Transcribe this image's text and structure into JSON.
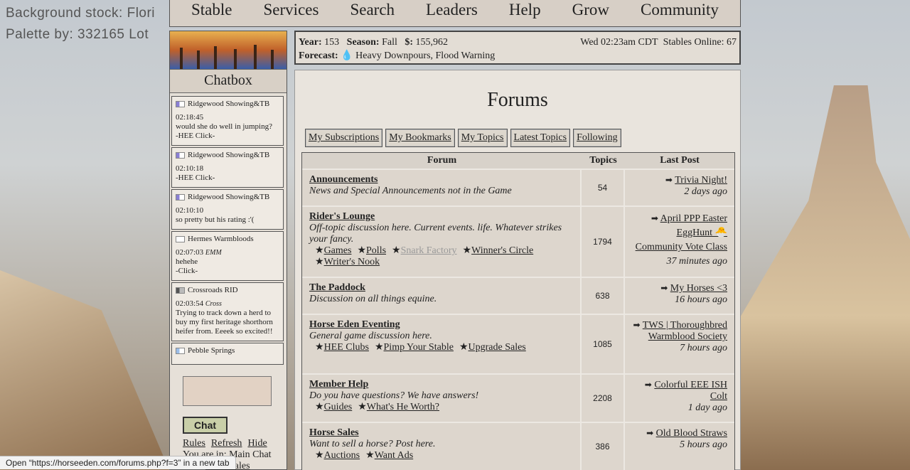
{
  "background": {
    "line1": "Background stock: Flori",
    "line2": "Palette by: 332165 Lot"
  },
  "nav": [
    "Stable",
    "Services",
    "Search",
    "Leaders",
    "Help",
    "Grow",
    "Community"
  ],
  "chatbox": {
    "title": "Chatbox",
    "messages": [
      {
        "user": "Ridgewood Showing&TB",
        "time": "02:18:45",
        "tag": "",
        "text": "would she do well in jumping?",
        "link": "-HEE Click-",
        "flag": "#8a7fd4"
      },
      {
        "user": "Ridgewood Showing&TB",
        "time": "02:10:18",
        "tag": "",
        "text": "",
        "link": "-HEE Click-",
        "flag": "#8a7fd4"
      },
      {
        "user": "Ridgewood Showing&TB",
        "time": "02:10:10",
        "tag": "",
        "text": "so pretty but his rating :'(",
        "link": "",
        "flag": "#8a7fd4"
      },
      {
        "user": "Hermes Warmbloods",
        "time": "02:07:03",
        "tag": "EMM",
        "text": "hehehe",
        "link": "-Click-",
        "flag": "#ffffff"
      },
      {
        "user": "Crossroads RID",
        "time": "02:03:54",
        "tag": "Cross",
        "text": "Trying to track down a herd to buy my first heritage shorthorn heifer from. Eeeek so excited!!",
        "link": "",
        "flag": "#555555"
      },
      {
        "user": "Pebble Springs",
        "time": "",
        "tag": "",
        "text": "",
        "link": "",
        "flag": "#9bbde8"
      }
    ],
    "chat_button": "Chat",
    "links": [
      "Rules",
      "Refresh",
      "Hide"
    ],
    "location": "You are in: Main Chat",
    "sales": "View Sales"
  },
  "info": {
    "year_label": "Year:",
    "year": "153",
    "season_label": "Season:",
    "season": "Fall",
    "money_label": "$:",
    "money": "155,962",
    "time": "Wed 02:23am CDT",
    "online": "Stables Online: 67",
    "forecast_label": "Forecast:",
    "forecast": "Heavy Downpours, Flood Warning"
  },
  "forums": {
    "title": "Forums",
    "tabs": [
      "My Subscriptions",
      "My Bookmarks",
      "My Topics",
      "Latest Topics",
      "Following"
    ],
    "headers": [
      "Forum",
      "Topics",
      "Last Post"
    ],
    "rows": [
      {
        "name": "Announcements",
        "desc": "News and Special Announcements not in the Game",
        "subs": [],
        "topics": "54",
        "last": "Trivia Night!",
        "ago": "2 days ago"
      },
      {
        "name": "Rider's Lounge",
        "desc": "Off-topic discussion here. Current events. life. Whatever strikes your fancy.",
        "subs": [
          "Games",
          "Polls",
          "Snark Factory",
          "Winner's Circle",
          "Writer's Nook"
        ],
        "topics": "1794",
        "last": "April PPP Easter EggHunt 🐣 Community Vote Class",
        "ago": "37 minutes ago"
      },
      {
        "name": "The Paddock",
        "desc": "Discussion on all things equine.",
        "subs": [],
        "topics": "638",
        "last": "My Horses <3",
        "ago": "16 hours ago"
      },
      {
        "name": "Horse Eden Eventing",
        "desc": "General game discussion here.",
        "subs": [
          "HEE Clubs",
          "Pimp Your Stable",
          "Upgrade Sales"
        ],
        "topics": "1085",
        "last": "TWS | Thoroughbred Warmblood Society",
        "ago": "7 hours ago"
      },
      {
        "name": "Member Help",
        "desc": "Do you have questions? We have answers!",
        "subs": [
          "Guides",
          "What's He Worth?"
        ],
        "topics": "2208",
        "last": "Colorful EEE ISH Colt",
        "ago": "1 day ago"
      },
      {
        "name": "Horse Sales",
        "desc": "Want to sell a horse? Post here.",
        "subs": [
          "Auctions",
          "Want Ads"
        ],
        "topics": "386",
        "last": "Old Blood Straws",
        "ago": "5 hours ago"
      }
    ]
  },
  "status_bar": "Open “https://horseeden.com/forums.php?f=3” in a new tab"
}
